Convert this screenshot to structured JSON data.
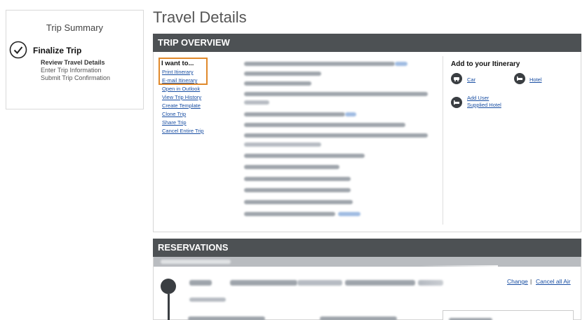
{
  "summary": {
    "title": "Trip Summary",
    "step": "Finalize Trip",
    "substeps": [
      "Review Travel Details",
      "Enter Trip Information",
      "Submit Trip Confirmation"
    ]
  },
  "page_title": "Travel Details",
  "overview": {
    "header": "TRIP OVERVIEW",
    "iwant_title": "I want to...",
    "actions": [
      "Print Itinerary",
      "E-mail Itinerary",
      "Open in Outlook",
      "View Trip History",
      "Create Template",
      "Clone Trip",
      "Share Trip",
      "Cancel Entire Trip"
    ],
    "add_title": "Add to your Itinerary",
    "add_car": "Car",
    "add_hotel": "Hotel",
    "add_user_hotel": "Add User Supplied Hotel"
  },
  "reservations": {
    "header": "RESERVATIONS",
    "change_label": "Change",
    "cancel_all_label": "Cancel all Air",
    "separator": "|"
  },
  "colors": {
    "header_bar": "#4d5154",
    "link": "#1a4fa3",
    "highlight": "#e0892b"
  }
}
